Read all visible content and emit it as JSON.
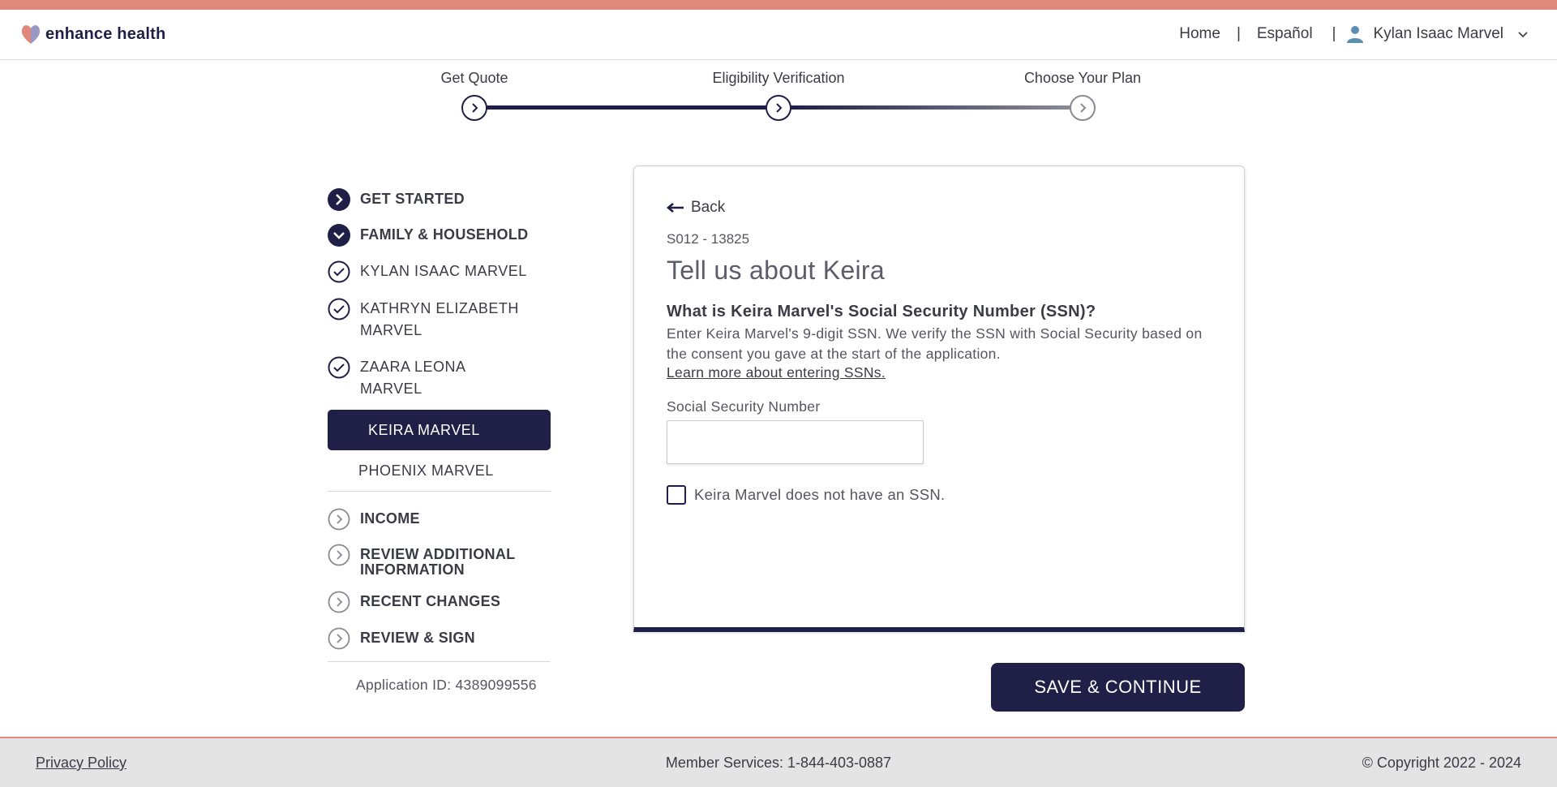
{
  "brand": {
    "name": "enhance health"
  },
  "nav": {
    "home": "Home",
    "language": "Español",
    "user_name": "Kylan Isaac Marvel"
  },
  "progress": {
    "steps": [
      {
        "label": "Get Quote",
        "status": "complete"
      },
      {
        "label": "Eligibility Verification",
        "status": "current"
      },
      {
        "label": "Choose Your Plan",
        "status": "upcoming"
      }
    ]
  },
  "sidebar": {
    "sections": [
      {
        "label": "GET STARTED",
        "icon": "chevron-right-filled-icon"
      },
      {
        "label": "FAMILY & HOUSEHOLD",
        "icon": "chevron-down-filled-icon"
      }
    ],
    "members_done": [
      {
        "line1": "KYLAN ISAAC MARVEL",
        "line2": ""
      },
      {
        "line1": "KATHRYN ELIZABETH",
        "line2": "MARVEL"
      },
      {
        "line1": "ZAARA LEONA",
        "line2": "MARVEL"
      }
    ],
    "active_member": "KEIRA MARVEL",
    "pending_member": "PHOENIX MARVEL",
    "later_sections": [
      {
        "line1": "INCOME",
        "line2": ""
      },
      {
        "line1": "REVIEW ADDITIONAL",
        "line2": "INFORMATION"
      },
      {
        "line1": "RECENT CHANGES",
        "line2": ""
      },
      {
        "line1": "REVIEW & SIGN",
        "line2": ""
      }
    ],
    "application_id": "Application ID: 4389099556"
  },
  "form": {
    "back_label": "Back",
    "code": "S012 - 13825",
    "title": "Tell us about Keira",
    "question": "What is Keira Marvel's Social Security Number (SSN)?",
    "description": "Enter Keira Marvel's 9-digit SSN. We verify the SSN with Social Security based on the consent you gave at the start of the application.",
    "learn_more": "Learn more about entering SSNs.",
    "ssn_label": "Social Security Number",
    "ssn_value": "",
    "no_ssn_label": "Keira Marvel does not have an SSN.",
    "no_ssn_checked": false
  },
  "actions": {
    "save_label": "SAVE & CONTINUE"
  },
  "footer": {
    "privacy": "Privacy Policy",
    "member_services": "Member Services: 1-844-403-0887",
    "copyright": "© Copyright 2022 - 2024"
  },
  "colors": {
    "navy": "#1f1f47",
    "accent": "#e0897a",
    "footer_bg": "#e4e4e4"
  }
}
